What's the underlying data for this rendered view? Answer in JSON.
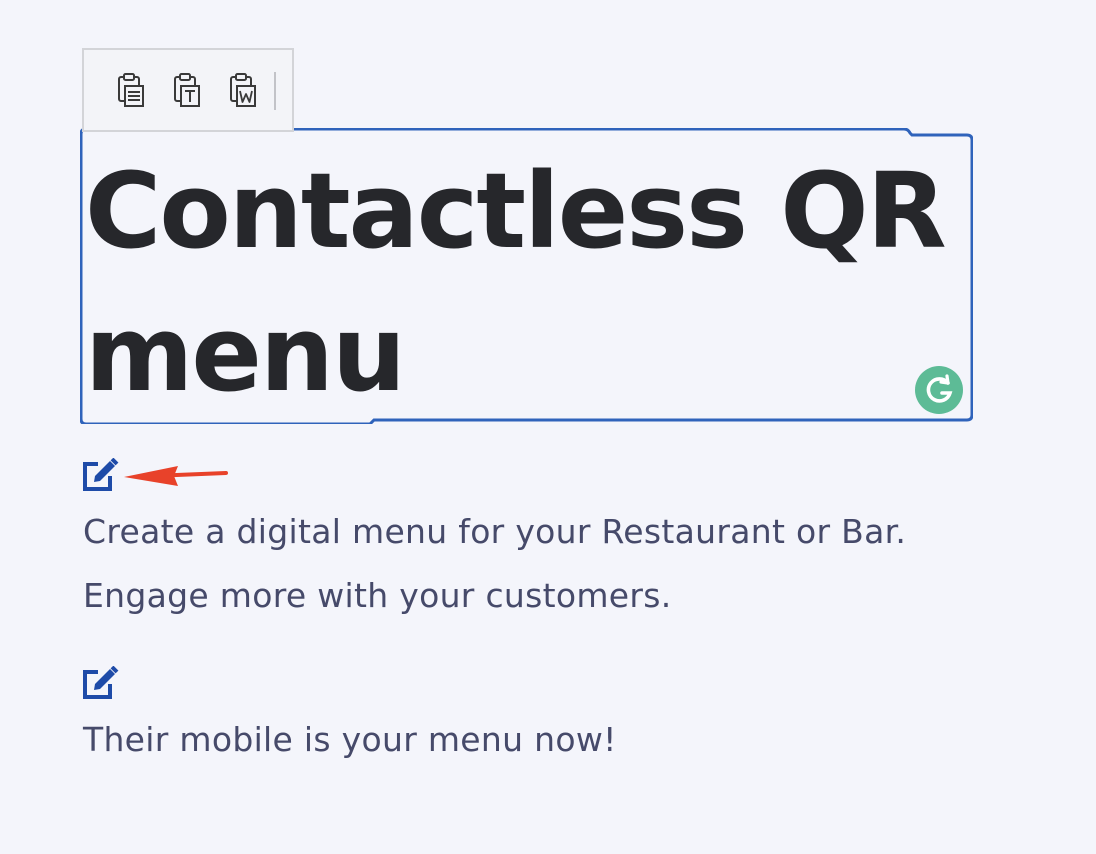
{
  "toolbar": {
    "buttons": [
      {
        "icon": "paste-formatted-icon"
      },
      {
        "icon": "paste-plain-text-icon"
      },
      {
        "icon": "paste-from-word-icon"
      }
    ]
  },
  "heading": {
    "text": "Contactless QR menu",
    "border_color": "#2f63bb"
  },
  "grammarly": {
    "icon": "grammarly-icon",
    "color": "#5dbb96"
  },
  "description": {
    "line1": "Create a digital menu for your Restaurant or Bar.",
    "line2": "Engage more with your customers."
  },
  "tagline": {
    "text": "Their mobile is your menu now!"
  },
  "colors": {
    "edit_icon": "#1e4ba8",
    "annotation_arrow": "#e8422a",
    "body_text": "#464a6a",
    "heading_text": "#26272b",
    "background": "#f4f5fb"
  }
}
